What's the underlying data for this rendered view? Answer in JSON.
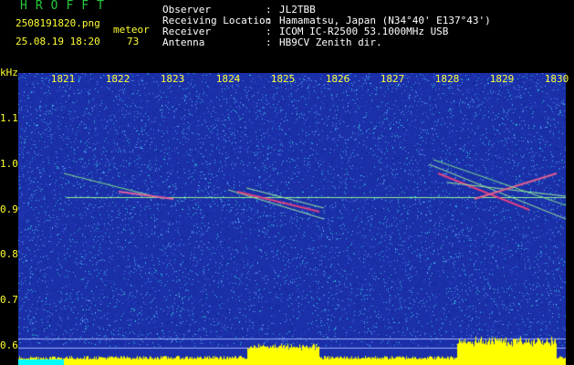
{
  "header": {
    "title": "HROFFT",
    "filename": "2508191820.png",
    "meteor_label": "meteor",
    "datetime": "25.08.19 18:20",
    "meteor_count": "73",
    "fields": [
      {
        "label": "Observer",
        "value": "JL2TBB"
      },
      {
        "label": "Receiving Location",
        "value": "Hamamatsu, Japan (N34°40' E137°43')"
      },
      {
        "label": "Receiver",
        "value": "ICOM IC-R2500 53.1000MHz USB"
      },
      {
        "label": "Antenna",
        "value": "HB9CV Zenith dir."
      }
    ],
    "colon": ":"
  },
  "axis": {
    "y_unit": "kHz",
    "y_ticks": [
      "1.1",
      "1.0",
      "0.9",
      "0.8",
      "0.7",
      "0.6"
    ],
    "x_ticks": [
      "1821",
      "1822",
      "1823",
      "1824",
      "1825",
      "1826",
      "1827",
      "1828",
      "1829",
      "1830"
    ]
  },
  "colors": {
    "background": "#000000",
    "waterfall": "#1a2fa8",
    "text_yellow": "#ffff33",
    "title_green": "#27c93f",
    "trace": "#90ee90",
    "spectrum": "#ffff00",
    "cyan_floor": "#00ffff"
  }
}
